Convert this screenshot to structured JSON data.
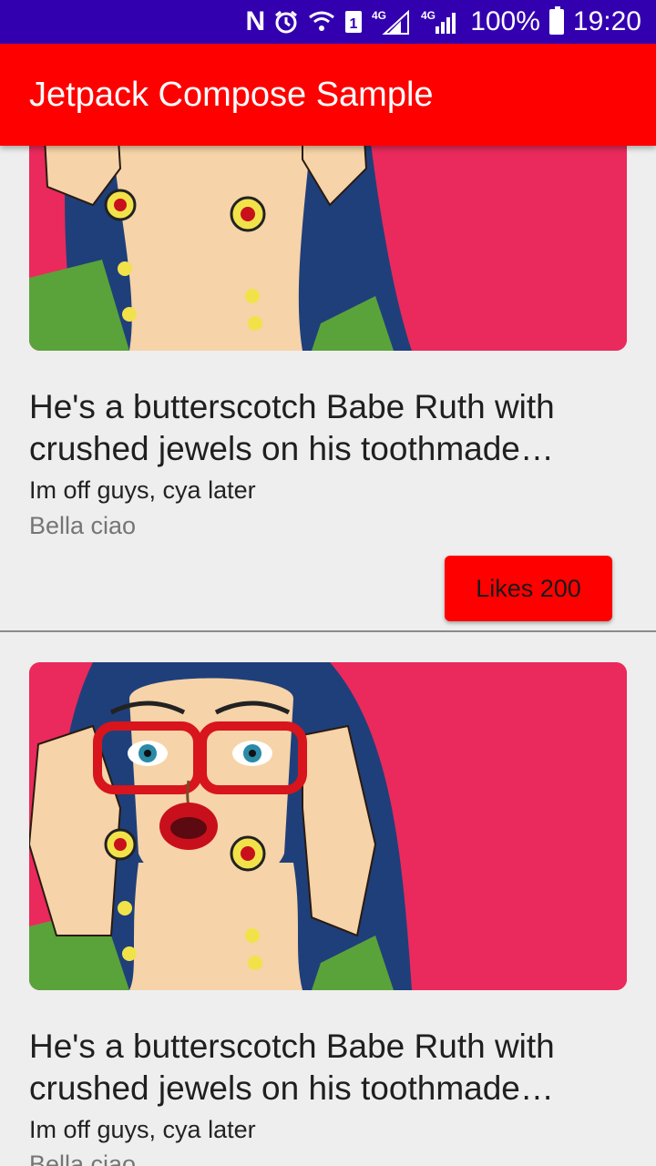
{
  "status_bar": {
    "icons": [
      "n-notification-icon",
      "alarm-icon",
      "wifi-icon",
      "sim-1-icon",
      "4g-signal-icon",
      "4g-signal-icon",
      "battery-icon"
    ],
    "sim_label": "1",
    "net1": "4G",
    "net2": "4G",
    "battery": "100%",
    "time": "19:20"
  },
  "app_bar": {
    "title": "Jetpack Compose Sample",
    "color": "#ff0000"
  },
  "posts": [
    {
      "image": "pop-art-woman-image",
      "title_line1": "He's a butterscotch Babe Ruth with",
      "title_line2": "crushed jewels on his toothmade…",
      "subtitle": "Im off guys, cya later",
      "caption": "Bella ciao",
      "likes_label": "Likes 200"
    },
    {
      "image": "pop-art-woman-image",
      "title_line1": "He's a butterscotch Babe Ruth with",
      "title_line2": "crushed jewels on his toothmade…",
      "subtitle": "Im off guys, cya later",
      "caption": "Bella ciao"
    }
  ],
  "colors": {
    "status_bar": "#3300b0",
    "accent": "#ff0000",
    "image_background": "#ea2a5c",
    "page_background": "#eeeeee"
  }
}
